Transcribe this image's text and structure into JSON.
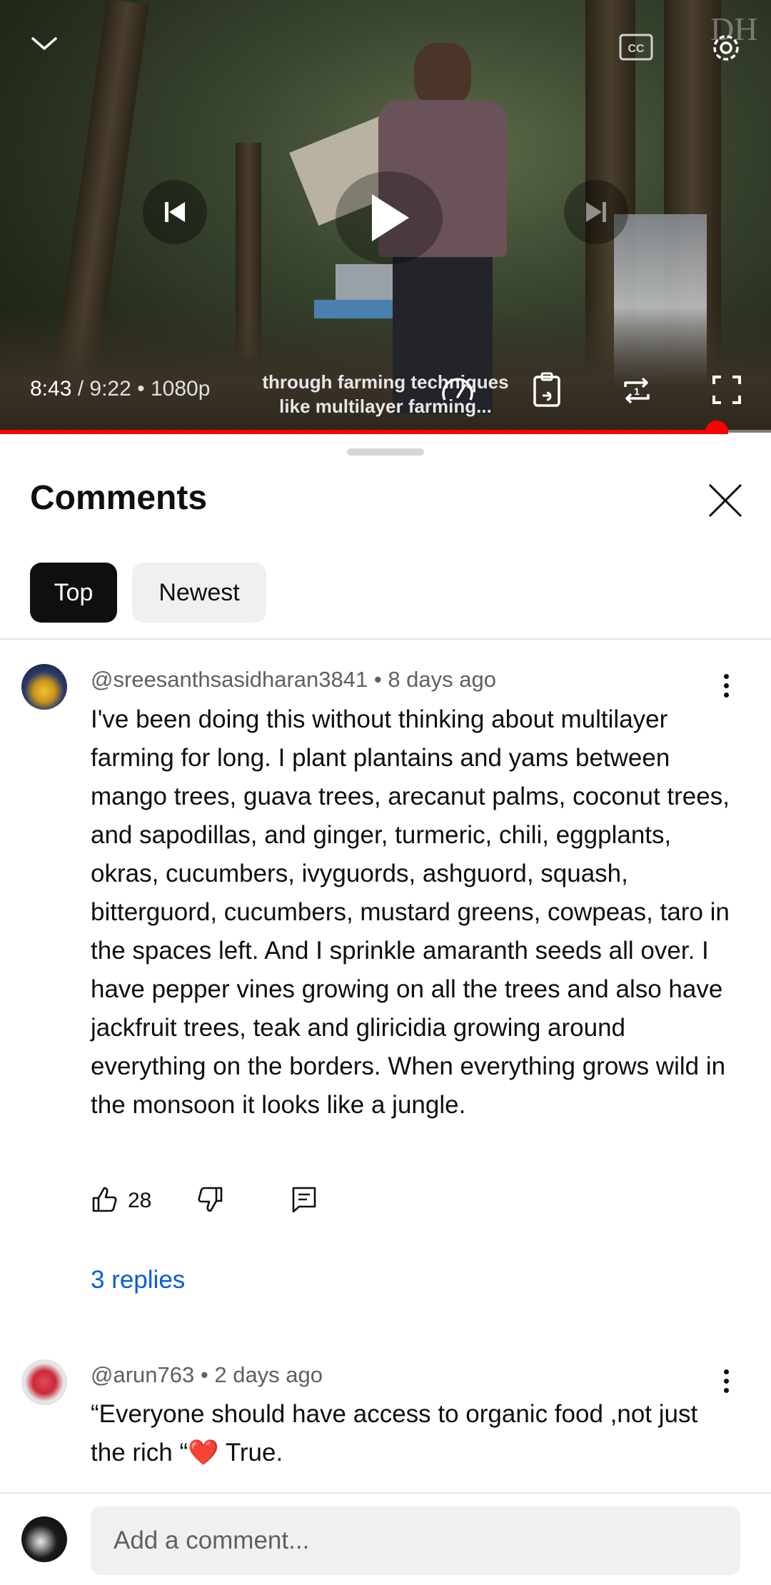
{
  "player": {
    "current_time": "8:43",
    "separator": " / ",
    "duration": "9:22",
    "bullet": " • ",
    "quality": "1080p",
    "caption_line1": "through farming techniques",
    "caption_line2": "like multilayer farming...",
    "watermark": "DH",
    "progress_fraction": 0.93,
    "accent": "#ff0000",
    "icons": [
      "chevron-down-icon",
      "cc-icon",
      "gear-icon",
      "previous-icon",
      "play-icon",
      "next-icon",
      "speed-icon",
      "clipboard-link-icon",
      "loop-icon",
      "fullscreen-icon"
    ]
  },
  "comments_panel": {
    "title": "Comments",
    "tabs": [
      {
        "label": "Top",
        "selected": true
      },
      {
        "label": "Newest",
        "selected": false
      }
    ]
  },
  "comments": [
    {
      "author": "@sreesanthsasidharan3841",
      "age": "8 days ago",
      "text": "I've been doing this without thinking about multilayer farming for long. I plant plantains and yams between mango trees, guava trees, arecanut palms, coconut trees, and sapodillas, and ginger, turmeric, chili, eggplants, okras, cucumbers, ivyguords, ashguord, squash, bitterguord, cucumbers, mustard greens, cowpeas, taro in the spaces left. And I sprinkle amaranth seeds all over. I have pepper vines growing on all the trees and also have  jackfruit trees, teak and gliricidia  growing around everything on the borders. When everything grows wild in the monsoon it looks like a jungle.",
      "likes": "28",
      "replies": "3 replies"
    },
    {
      "author": "@arun763",
      "age": "2 days ago",
      "text": "“Everyone should have access to organic food ,not just the rich “❤️ True."
    }
  ],
  "composer": {
    "placeholder": "Add a comment..."
  }
}
